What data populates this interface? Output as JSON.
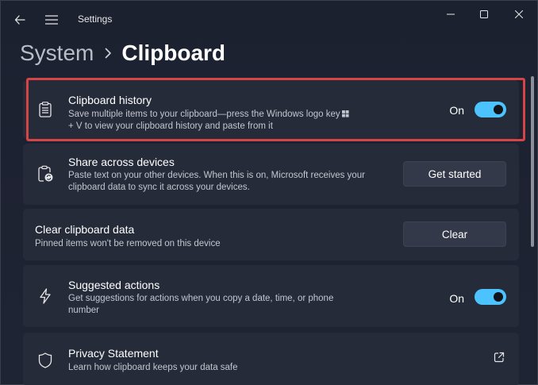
{
  "window": {
    "title": "Settings"
  },
  "breadcrumb": {
    "parent": "System",
    "current": "Clipboard"
  },
  "cards": {
    "history": {
      "title": "Clipboard history",
      "desc_line1": "Save multiple items to your clipboard—press the Windows logo key",
      "desc_line2": "+ V to view your clipboard history and paste from it",
      "toggle_label": "On",
      "toggle_on": true
    },
    "share": {
      "title": "Share across devices",
      "desc_line1": "Paste text on your other devices. When this is on, Microsoft receives your",
      "desc_line2": "clipboard data to sync it across your devices.",
      "button": "Get started"
    },
    "clear": {
      "title": "Clear clipboard data",
      "desc": "Pinned items won't be removed on this device",
      "button": "Clear"
    },
    "suggested": {
      "title": "Suggested actions",
      "desc_line1": "Get suggestions for actions when you copy a date, time, or phone",
      "desc_line2": "number",
      "toggle_label": "On",
      "toggle_on": true
    },
    "privacy": {
      "title": "Privacy Statement",
      "desc": "Learn how clipboard keeps your data safe"
    }
  },
  "colors": {
    "accent": "#4cc2ff",
    "highlight": "#d64545",
    "card_bg": "#262b3a"
  },
  "icons": {
    "back": "back-arrow-icon",
    "menu": "hamburger-menu-icon",
    "history": "clipboard-list-icon",
    "share": "clipboard-sync-icon",
    "suggested": "lightning-icon",
    "privacy": "shield-icon",
    "external": "open-external-icon"
  }
}
